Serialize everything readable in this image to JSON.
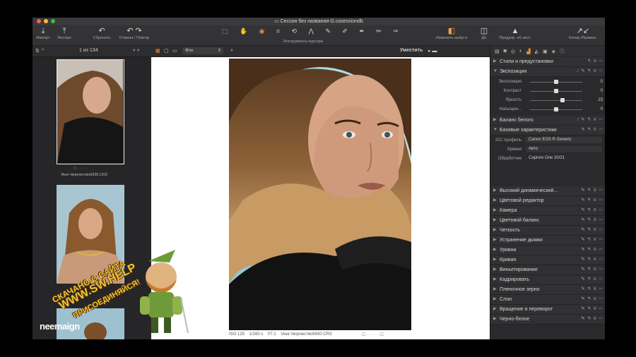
{
  "window": {
    "title": "Сессия без названия-G.cosessiondb"
  },
  "toolbar": {
    "import": "Импорт",
    "export": "Экспорт",
    "reset": "Сбросить",
    "undo_redo": "Отмена / Повтор",
    "cursor_tools": "Инструменты курсора",
    "change_selected": "Изменить выбр-е",
    "to": "До",
    "preview_exposure": "Предупр. об эксп.",
    "copy_apply": "Копир./Примен."
  },
  "browser": {
    "counter": "1 из 134",
    "filter": "Фон",
    "fit": "Уместить",
    "selected_filename": "\\Аня творчество6930.CR3"
  },
  "viewer": {
    "iso": "ISO 125",
    "shutter": "1/160 s",
    "aperture": "f/7.1",
    "filename": "\\Аня творчество6930.CR3"
  },
  "tools": {
    "styles": "Стили и предустановки",
    "exposure": "Экспозиция",
    "sliders": [
      {
        "label": "Экспозиция",
        "value": "0",
        "pos": 0.5
      },
      {
        "label": "Контраст",
        "value": "0",
        "pos": 0.5
      },
      {
        "label": "Яркость",
        "value": "23",
        "pos": 0.62
      },
      {
        "label": "Насыщен...",
        "value": "0",
        "pos": 0.5
      }
    ],
    "white_balance": "Баланс белого",
    "basic": "Базовые характеристики",
    "icc_label": "ICC профиль",
    "icc_value": "Canon EOS R Generic",
    "curve_label": "Кривая",
    "curve_value": "Авто",
    "engine_label": "Обработчик",
    "engine_value": "Capture One 20/21",
    "sections": [
      "Высокий динамический...",
      "Цветовой редактор",
      "Камера",
      "Цветовой баланс",
      "Четкость",
      "Устранение дымки",
      "Уровни",
      "Кривая",
      "Виньетирование",
      "Кадрировать",
      "Пленочное зерно",
      "Слои",
      "Вращение и переворот",
      "Черно-белое"
    ]
  },
  "watermark": {
    "line1": "СКАЧАНО С САЙТА",
    "line2": "WWW.SW.HELP",
    "line3": "ПРИСОЕДИНЯЙСЯ!",
    "brand": "neemaign"
  }
}
